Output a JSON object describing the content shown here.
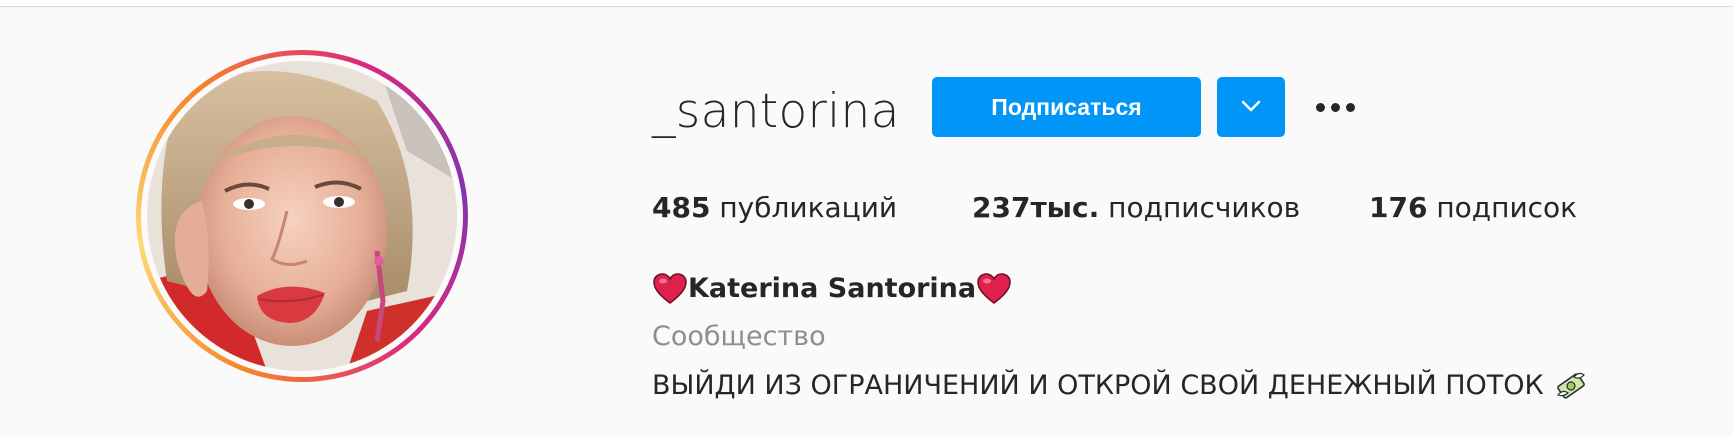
{
  "profile": {
    "username": "_santorina",
    "follow_label": "Подписаться",
    "more_label": "•••",
    "full_name": "Katerina Santorina",
    "category": "Сообщество",
    "bio": "ВЫЙДИ ИЗ ОГРАНИЧЕНИЙ И ОТКРОЙ СВОЙ ДЕНЕЖНЫЙ ПОТОК"
  },
  "stats": {
    "posts": {
      "count": "485",
      "label": "публикаций"
    },
    "followers": {
      "count": "237тыс.",
      "label": "подписчиков"
    },
    "following": {
      "count": "176",
      "label": "подписок"
    }
  },
  "icons": {
    "dropdown": "chevron-down-icon",
    "more": "more-horizontal-icon",
    "name_decoration": "red-heart-icon",
    "bio_decoration": "money-with-wings-icon"
  },
  "colors": {
    "accent": "#0095f6",
    "text": "#262626",
    "secondary_text": "#8e8e8e",
    "background": "#fafafa"
  }
}
